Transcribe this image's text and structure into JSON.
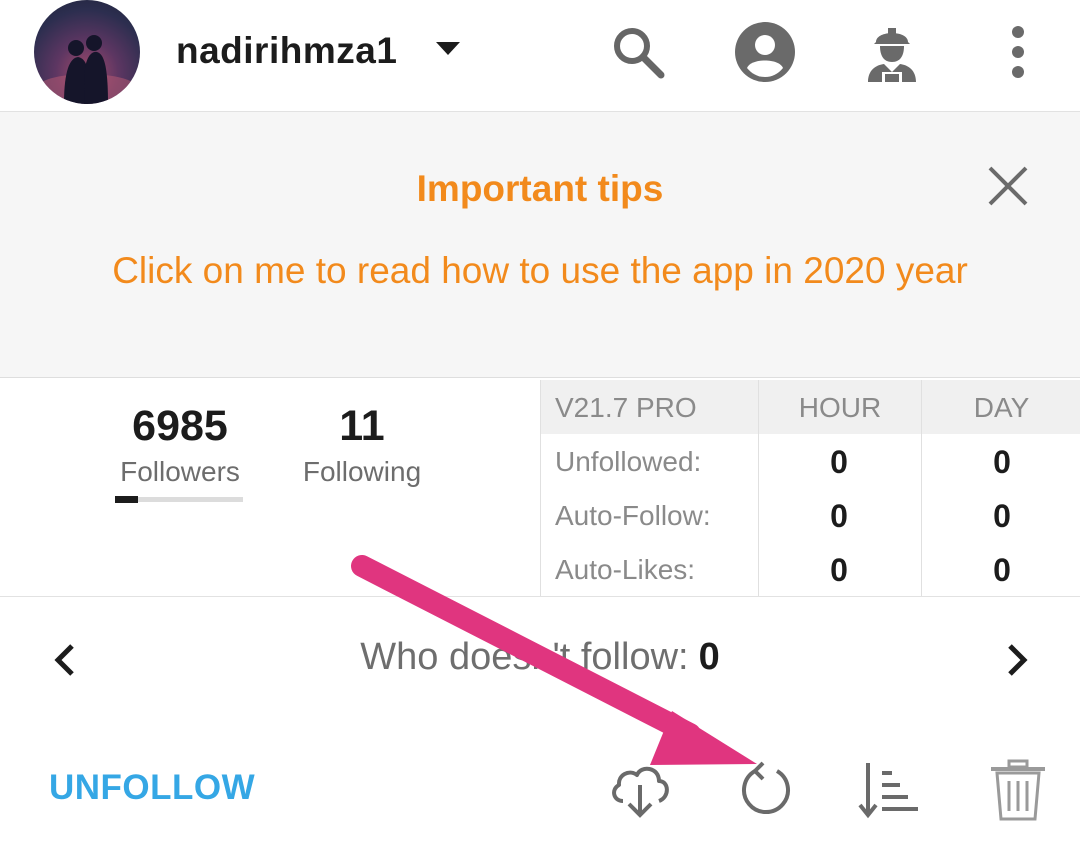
{
  "header": {
    "username": "nadirihmza1",
    "icons": [
      "search-icon",
      "account-icon",
      "worker-icon",
      "more-vert-icon"
    ]
  },
  "tips": {
    "title": "Important tips",
    "body": "Click on me to read how to use the app in 2020 year"
  },
  "stats": {
    "followers": {
      "count": "6985",
      "label": "Followers",
      "progress": 0.18
    },
    "following": {
      "count": "11",
      "label": "Following"
    }
  },
  "table": {
    "version": "V21.7 PRO",
    "columns": [
      "HOUR",
      "DAY"
    ],
    "rows": [
      {
        "label": "Unfollowed:",
        "hour": "0",
        "day": "0"
      },
      {
        "label": "Auto-Follow:",
        "hour": "0",
        "day": "0"
      },
      {
        "label": "Auto-Likes:",
        "hour": "0",
        "day": "0"
      }
    ]
  },
  "filter": {
    "label": "Who doesn't follow:",
    "count": "0"
  },
  "actions": {
    "unfollow_label": "UNFOLLOW",
    "icons": [
      "cloud-download-icon",
      "refresh-icon",
      "sort-icon",
      "trash-icon"
    ]
  },
  "colors": {
    "accent_orange": "#f28a1c",
    "accent_blue": "#35a7e5",
    "annotation_pink": "#e0357f"
  }
}
